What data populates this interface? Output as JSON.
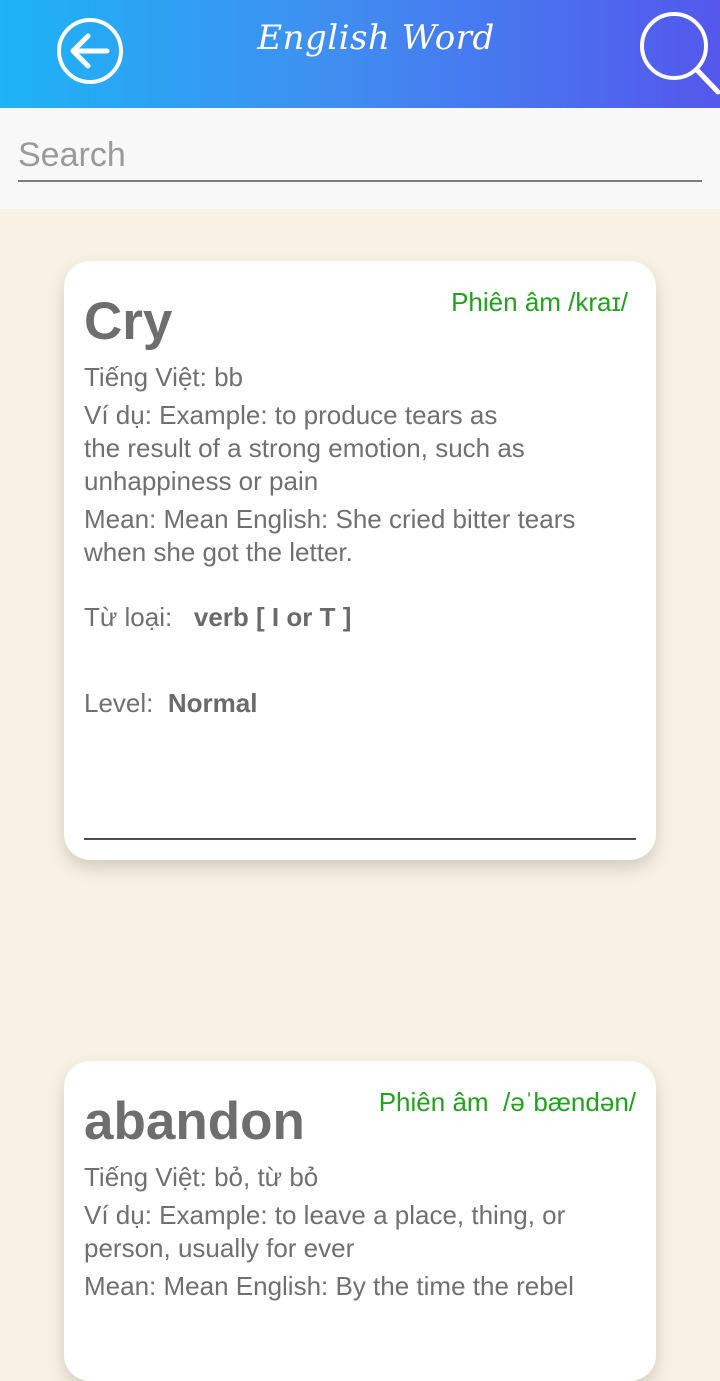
{
  "header": {
    "title": "English Word",
    "back_icon": "arrow-left-circle-icon",
    "search_icon": "magnifier-icon"
  },
  "search": {
    "placeholder": "Search",
    "value": ""
  },
  "colors": {
    "header_gradient_start": "#1db3f5",
    "header_gradient_end": "#5457ec",
    "phonetic_green": "#20a31c",
    "background": "#f9f2e4"
  },
  "words": [
    {
      "word": "Cry",
      "phonetic_label": "Phiên âm",
      "phonetic": "/kraɪ/",
      "vietnamese_label": "Tiếng Việt:",
      "vietnamese": "bb",
      "example_label": "Ví dụ:",
      "example_lines": [
        "Example: to produce tears as",
        "the result of a strong emotion, such as",
        "unhappiness or pain"
      ],
      "mean_label": "Mean:",
      "mean_lines": [
        "Mean English: She cried bitter tears",
        "when she got the letter."
      ],
      "type_label": "Từ loại:",
      "type": "verb [ I or T ]",
      "level_label": "Level:",
      "level": "Normal"
    },
    {
      "word": "abandon",
      "phonetic_label": "Phiên âm",
      "phonetic": "/əˈbændən/",
      "vietnamese_label": "Tiếng Việt:",
      "vietnamese": "bỏ, từ bỏ",
      "example_label": "Ví dụ:",
      "example_lines": [
        "Example: to leave a place, thing, or",
        "person, usually for ever"
      ],
      "mean_label": "Mean:",
      "mean_lines": [
        "Mean English: By the time the rebel"
      ]
    }
  ]
}
